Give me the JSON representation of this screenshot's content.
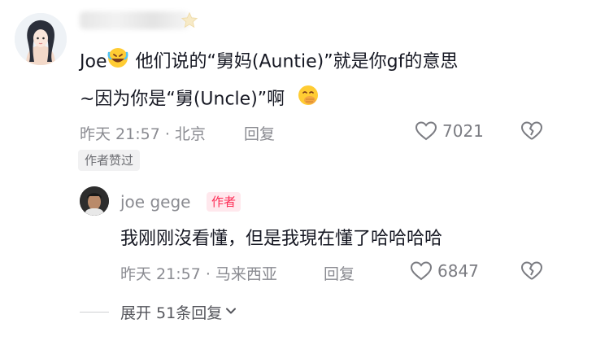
{
  "comment": {
    "username_blurred": true,
    "text_line1_part1": "Joe",
    "text_line1_part2": " 他们说的“舅妈(Auntie)”就是你gf的意思",
    "text_line2": "~因为你是“舅(Uncle)”啊",
    "timestamp": "昨天 21:57 · 北京",
    "reply_label": "回复",
    "like_count": "7021",
    "liked_by_author_badge": "作者赞过",
    "emoji_1": "rofl-emoji",
    "emoji_2": "hand-over-mouth-emoji"
  },
  "reply": {
    "username": "joe gege",
    "author_tag": "作者",
    "text": "我刚刚沒看懂，但是我現在懂了哈哈哈哈",
    "timestamp": "昨天 21:57 · 马来西亚",
    "reply_label": "回复",
    "like_count": "6847"
  },
  "expand": {
    "label": "展开 51条回复"
  },
  "colors": {
    "accent": "#fe2c55",
    "meta": "#8a8b91"
  },
  "icons": [
    "heart-outline-icon",
    "broken-heart-icon",
    "chevron-down-icon",
    "star-icon"
  ]
}
